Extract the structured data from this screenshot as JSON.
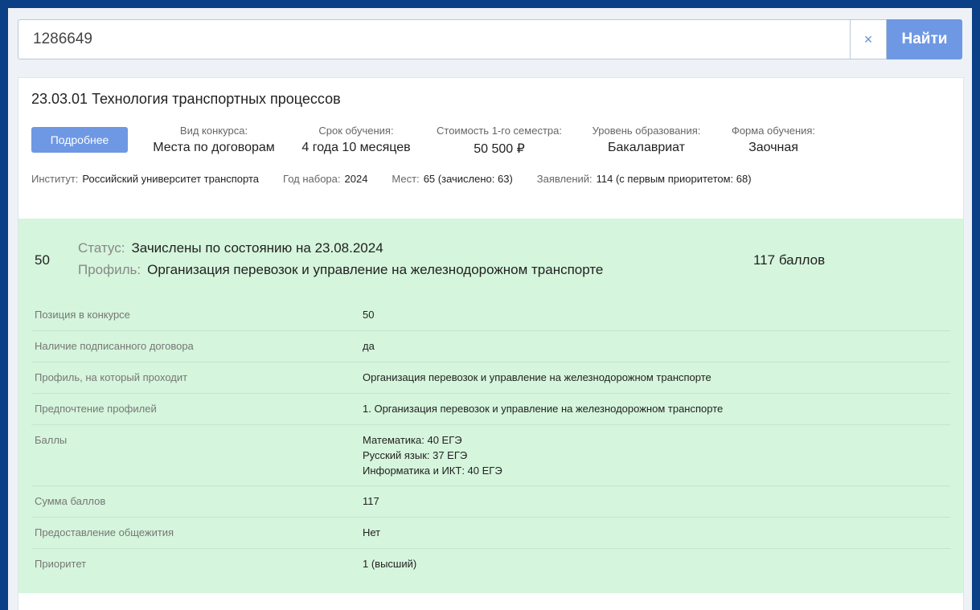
{
  "search": {
    "value": "1286649",
    "clear_label": "×",
    "submit_label": "Найти"
  },
  "program": {
    "title": "23.03.01 Технология транспортных процессов",
    "more_label": "Подробнее",
    "info": [
      {
        "label": "Вид конкурса:",
        "value": "Места по договорам"
      },
      {
        "label": "Срок обучения:",
        "value": "4 года 10 месяцев"
      },
      {
        "label": "Стоимость 1-го семестра:",
        "value": "50 500 ₽"
      },
      {
        "label": "Уровень образования:",
        "value": "Бакалавриат"
      },
      {
        "label": "Форма обучения:",
        "value": "Заочная"
      }
    ],
    "meta": [
      {
        "label": "Институт:",
        "value": "Российский университет транспорта"
      },
      {
        "label": "Год набора:",
        "value": "2024"
      },
      {
        "label": "Мест:",
        "value": "65 (зачислено: 63)"
      },
      {
        "label": "Заявлений:",
        "value": "114 (с первым приоритетом: 68)"
      }
    ]
  },
  "applicant": {
    "position": "50",
    "status_label": "Статус:",
    "status_value": "Зачислены по состоянию на 23.08.2024",
    "profile_label": "Профиль:",
    "profile_value": "Организация перевозок и управление на железнодорожном транспорте",
    "score_total": "117 баллов",
    "details": [
      {
        "label": "Позиция в конкурсе",
        "value": [
          "50"
        ]
      },
      {
        "label": "Наличие подписанного договора",
        "value": [
          "да"
        ]
      },
      {
        "label": "Профиль, на который проходит",
        "value": [
          "Организация перевозок и управление на железнодорожном транспорте"
        ]
      },
      {
        "label": "Предпочтение профилей",
        "value": [
          "1. Организация перевозок и управление на железнодорожном транспорте"
        ]
      },
      {
        "label": "Баллы",
        "value": [
          "Математика: 40 ЕГЭ",
          "Русский язык: 37 ЕГЭ",
          "Информатика и ИКТ: 40 ЕГЭ"
        ]
      },
      {
        "label": "Сумма баллов",
        "value": [
          "117"
        ]
      },
      {
        "label": "Предоставление общежития",
        "value": [
          "Нет"
        ]
      },
      {
        "label": "Приоритет",
        "value": [
          "1 (высший)"
        ]
      }
    ]
  },
  "colors": {
    "accent": "#6e98e3",
    "frame": "#0b3f86",
    "success_bg": "#d5f5dc"
  }
}
